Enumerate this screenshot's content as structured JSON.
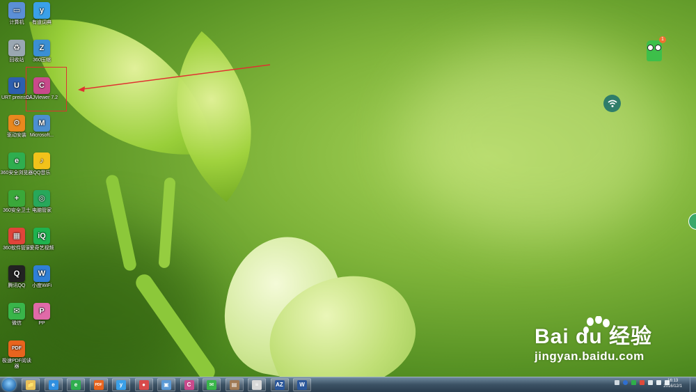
{
  "desktop": {
    "icons": [
      {
        "label": "计算机",
        "name": "computer-icon",
        "color": "#5b8fd6",
        "glyph": "▭"
      },
      {
        "label": "有道词典",
        "name": "youdao-dict-icon",
        "color": "#3aa0e8",
        "glyph": "y"
      },
      {
        "label": "回收站",
        "name": "recycle-bin-icon",
        "color": "#9aa7b2",
        "glyph": "♻"
      },
      {
        "label": "360压缩",
        "name": "360-zip-icon",
        "color": "#3b8fd4",
        "glyph": "Z"
      },
      {
        "label": "URT preinstall",
        "name": "urt-preinstall-icon",
        "color": "#2d5fb0",
        "glyph": "U"
      },
      {
        "label": "CAJViewer 7.2",
        "name": "cajviewer-icon",
        "color": "#c94a8c",
        "glyph": "C"
      },
      {
        "label": "驱动安装",
        "name": "driver-install-icon",
        "color": "#e8881e",
        "glyph": "⚙"
      },
      {
        "label": "Microsoft...",
        "name": "microsoft-icon",
        "color": "#4c8fd0",
        "glyph": "M"
      },
      {
        "label": "360安全浏览器",
        "name": "360-browser-icon",
        "color": "#2fae4f",
        "glyph": "e"
      },
      {
        "label": "QQ音乐",
        "name": "qq-music-icon",
        "color": "#f2c21a",
        "glyph": "♪"
      },
      {
        "label": "360安全卫士",
        "name": "360-safe-icon",
        "color": "#3aa83a",
        "glyph": "+"
      },
      {
        "label": "电脑管家",
        "name": "pc-manager-icon",
        "color": "#27a85b",
        "glyph": "◎"
      },
      {
        "label": "360软件管家",
        "name": "360-soft-icon",
        "color": "#e0443a",
        "glyph": "▦"
      },
      {
        "label": "爱奇艺视频",
        "name": "iqiyi-icon",
        "color": "#1fb34f",
        "glyph": "iQ"
      },
      {
        "label": "腾讯QQ",
        "name": "qq-icon",
        "color": "#222222",
        "glyph": "Q"
      },
      {
        "label": "小度WiFi",
        "name": "xiaodu-wifi-icon",
        "color": "#2f7fd6",
        "glyph": "W"
      },
      {
        "label": "微信",
        "name": "wechat-icon",
        "color": "#39b54a",
        "glyph": "✉"
      },
      {
        "label": "PP",
        "name": "pp-icon",
        "color": "#e06aa8",
        "glyph": "P"
      },
      {
        "label": "极速PDF阅读器",
        "name": "pdf-reader-icon",
        "color": "#e8641e",
        "glyph": "PDF"
      }
    ]
  },
  "widgets": {
    "pet_badge": "1"
  },
  "watermark": {
    "brand": "Bai du 经验",
    "url": "jingyan.baidu.com"
  },
  "taskbar": {
    "apps": [
      {
        "name": "explorer-taskbar-icon",
        "glyph": "📁",
        "color": "#e8c25a"
      },
      {
        "name": "ie-taskbar-icon",
        "glyph": "e",
        "color": "#2f8fe0"
      },
      {
        "name": "360-browser-taskbar-icon",
        "glyph": "e",
        "color": "#2fae4f"
      },
      {
        "name": "pdf-taskbar-icon",
        "glyph": "PDF",
        "color": "#e8641e"
      },
      {
        "name": "youdao-taskbar-icon",
        "glyph": "y",
        "color": "#3aa0e8"
      },
      {
        "name": "media-taskbar-icon",
        "glyph": "●",
        "color": "#d84a4a"
      },
      {
        "name": "photo-taskbar-icon",
        "glyph": "▣",
        "color": "#5c9ad6"
      },
      {
        "name": "cajviewer-taskbar-icon",
        "glyph": "C",
        "color": "#c94a8c"
      },
      {
        "name": "wechat-taskbar-icon",
        "glyph": "✉",
        "color": "#39b54a"
      },
      {
        "name": "image-taskbar-icon",
        "glyph": "▤",
        "color": "#a07a55"
      },
      {
        "name": "notepad-taskbar-icon",
        "glyph": "≡",
        "color": "#d8d8d8"
      },
      {
        "name": "word-az-taskbar-icon",
        "glyph": "AZ",
        "color": "#2b579a"
      },
      {
        "name": "word-taskbar-icon",
        "glyph": "W",
        "color": "#2b579a"
      }
    ],
    "clock_time": "16:13",
    "clock_date": "2016/12/1"
  }
}
